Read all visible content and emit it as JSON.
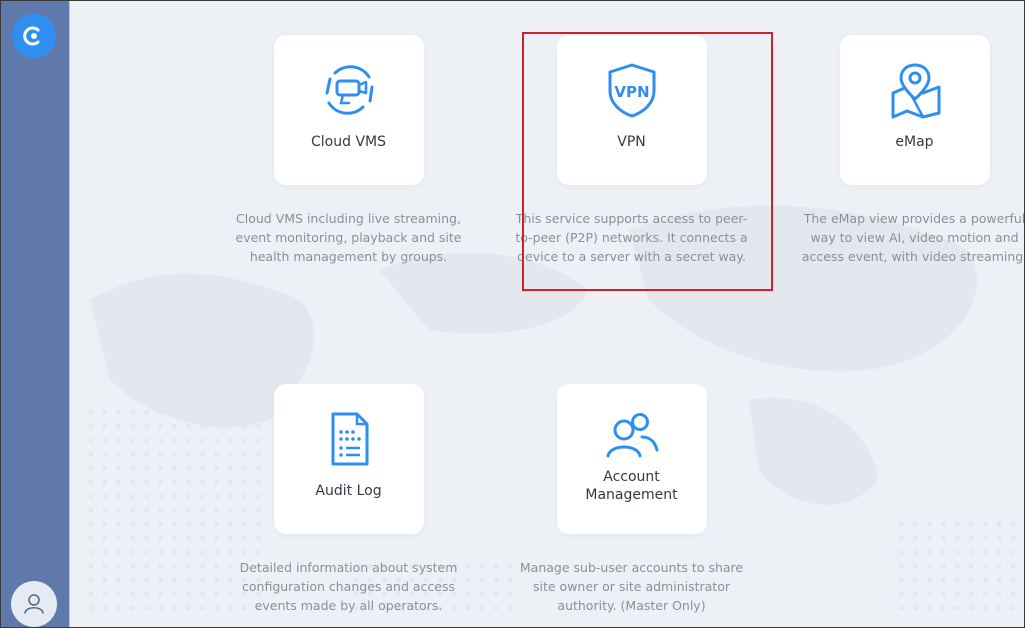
{
  "sidebar": {
    "logo_icon": "cloud-logo-icon",
    "avatar_icon": "user-icon"
  },
  "tiles": [
    {
      "title": "Cloud VMS",
      "icon": "camera-cloud-icon",
      "description": "Cloud VMS including live streaming, event monitoring, playback and site health management by groups."
    },
    {
      "title": "VPN",
      "icon": "vpn-shield-icon",
      "description": "This service supports access to peer-to-peer (P2P) networks. It connects a device to a server with a secret way."
    },
    {
      "title": "eMap",
      "icon": "map-pin-icon",
      "description": "The eMap view provides a powerful way to view AI, video motion and access event, with video streaming."
    },
    {
      "title": "Audit Log",
      "icon": "document-list-icon",
      "description": "Detailed information about system configuration changes and access events made by all operators."
    },
    {
      "title": "Account Management",
      "icon": "users-icon",
      "description": "Manage sub-user accounts to share site owner or site administrator authority. (Master Only)"
    }
  ],
  "colors": {
    "accent": "#2f8ff0",
    "sidebar": "#5f79ab",
    "highlight": "#d2202a"
  }
}
